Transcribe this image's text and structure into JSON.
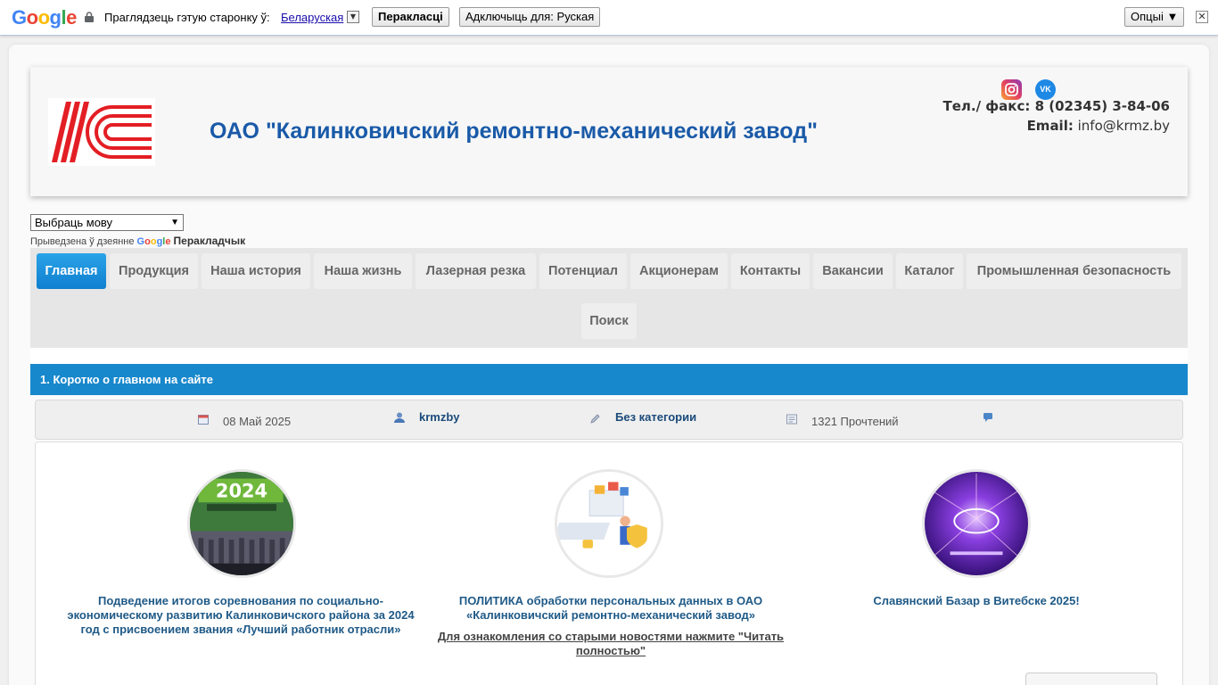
{
  "translate_bar": {
    "prompt": "Праглядзець гэтую старонку ў:",
    "language": "Беларуская",
    "translate_button": "Перакласці",
    "disable_button": "Адключыць для: Руская",
    "options_button": "Опцыі ▼",
    "close": "✕"
  },
  "header": {
    "title": "ОАО \"Калинковичский ремонтно-механический завод\"",
    "phone": "Тел./ факс: 8 (02345) 3-84-06",
    "email_label": "Email:",
    "email": "info@krmz.by",
    "vk_label": "VK"
  },
  "language_select": {
    "value": "Выбраць мову",
    "powered_text": "Прыведзена ў дзеянне",
    "powered_brand": "Перакладчык"
  },
  "nav": {
    "items": [
      "Главная",
      "Продукция",
      "Наша история",
      "Наша жизнь",
      "Лазерная резка",
      "Потенциал",
      "Акционерам",
      "Контакты",
      "Вакансии",
      "Каталог",
      "Промышленная безопасность",
      "Поиск"
    ]
  },
  "section": {
    "title": "1. Коротко о главном на сайте"
  },
  "meta": {
    "date": "08 Май 2025",
    "author": "krmzby",
    "category": "Без категории",
    "reads": "1321 Прочтений"
  },
  "articles": [
    {
      "caption": "Подведение итогов соревнования по социально-экономическому развитию Калинковичского района за 2024 год с присвоением звания «Лучший работник отрасли»"
    },
    {
      "caption": "ПОЛИТИКА обработки персональных данных в ОАО «Калинковичский ремонтно-механический завод»"
    },
    {
      "caption": "Славянский Базар в Витебске 2025!"
    }
  ],
  "old_news": "Для ознакомления со старыми новостями нажмите \"Читать полностью\"",
  "colors": {
    "accent": "#1888cc",
    "title": "#1a5aa8",
    "logo_red": "#e31e24"
  }
}
